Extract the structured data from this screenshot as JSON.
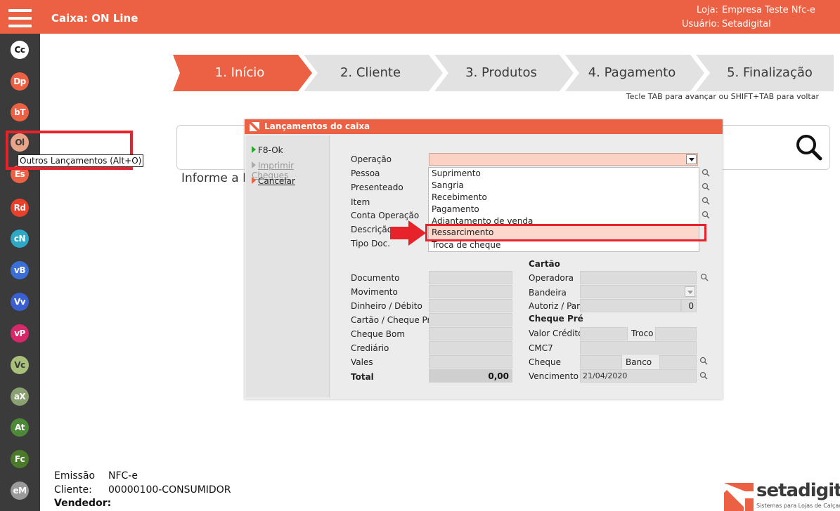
{
  "header": {
    "title": "Caixa: ON Line",
    "store_label": "Loja:",
    "store_value": "Empresa Teste Nfc-e",
    "user_label": "Usuário:",
    "user_value": "Setadigital",
    "accent": "#ec6143"
  },
  "sidebar": {
    "items": [
      {
        "label": "Cc",
        "color": "#ffffff",
        "text": "#111111"
      },
      {
        "label": "Dp",
        "color": "#ec6143",
        "text": "#ffffff"
      },
      {
        "label": "bT",
        "color": "#ec6143",
        "text": "#ffffff"
      },
      {
        "label": "Ol",
        "color": "#e8a488",
        "text": "#3a3a3a"
      },
      {
        "label": "Es",
        "color": "#ec6143",
        "text": "#ffffff"
      },
      {
        "label": "Rd",
        "color": "#e8402a",
        "text": "#ffffff"
      },
      {
        "label": "cN",
        "color": "#2ea8c4",
        "text": "#ffffff"
      },
      {
        "label": "vB",
        "color": "#3a6fd8",
        "text": "#ffffff"
      },
      {
        "label": "Vv",
        "color": "#3a5fd0",
        "text": "#ffffff"
      },
      {
        "label": "vP",
        "color": "#d8276a",
        "text": "#ffffff"
      },
      {
        "label": "Vc",
        "color": "#a8c07a",
        "text": "#3a3a3a"
      },
      {
        "label": "aX",
        "color": "#8aa070",
        "text": "#ffffff"
      },
      {
        "label": "At",
        "color": "#4c8a3a",
        "text": "#ffffff"
      },
      {
        "label": "Fc",
        "color": "#4a7a2a",
        "text": "#ffffff"
      },
      {
        "label": "eM",
        "color": "#9a9a9a",
        "text": "#ffffff"
      }
    ],
    "tooltip": "Outros Lançamentos (Alt+O)"
  },
  "steps": [
    {
      "label": "1. Início",
      "active": true
    },
    {
      "label": "2. Cliente",
      "active": false
    },
    {
      "label": "3. Produtos",
      "active": false
    },
    {
      "label": "4. Pagamento",
      "active": false
    },
    {
      "label": "5. Finalização",
      "active": false
    }
  ],
  "hint": "Tecle TAB para avançar ou SHIFT+TAB para voltar",
  "informe": "Informe a I",
  "modal": {
    "title": "Lançamentos do caixa",
    "actions": [
      "F8-Ok",
      "Imprimir Cheques",
      "Cancelar"
    ],
    "labels": {
      "operacao": "Operação",
      "pessoa": "Pessoa",
      "presenteado": "Presenteado",
      "item": "Item",
      "conta": "Conta Operação",
      "descricao": "Descrição",
      "tipo": "Tipo Doc.",
      "documento": "Documento",
      "movimento": "Movimento",
      "dinheiro": "Dinheiro / Débito",
      "cartao_cheque": "Cartão / Cheque Pré",
      "cheque_bom": "Cheque Bom",
      "crediario": "Crediário",
      "vales": "Vales",
      "total": "Total",
      "total_value": "0,00",
      "cartao_title": "Cartão",
      "operadora": "Operadora",
      "bandeira": "Bandeira",
      "autoriz": "Autoriz / Parc",
      "autoriz_value": "0",
      "cheque_pre_title": "Cheque Pré",
      "valor_credito": "Valor Crédito",
      "troco": "Troco",
      "cmc7": "CMC7",
      "cheque": "Cheque",
      "banco": "Banco",
      "vencimento": "Vencimento",
      "vencimento_value": "21/04/2020"
    },
    "dropdown_options": [
      "Suprimento",
      "Sangria",
      "Recebimento",
      "Pagamento",
      "Adiantamento de venda",
      "Ressarcimento",
      "Troca de cheque"
    ],
    "highlighted_option": "Ressarcimento"
  },
  "footer": {
    "emissao_label": "Emissão",
    "emissao_value": "NFC-e",
    "cliente_label": "Cliente:",
    "cliente_value": "00000100-CONSUMIDOR",
    "vendedor_label": "Vendedor:"
  },
  "logo": {
    "name": "setadigital",
    "tagline": "Sistemas para Lojas de Calçados"
  }
}
